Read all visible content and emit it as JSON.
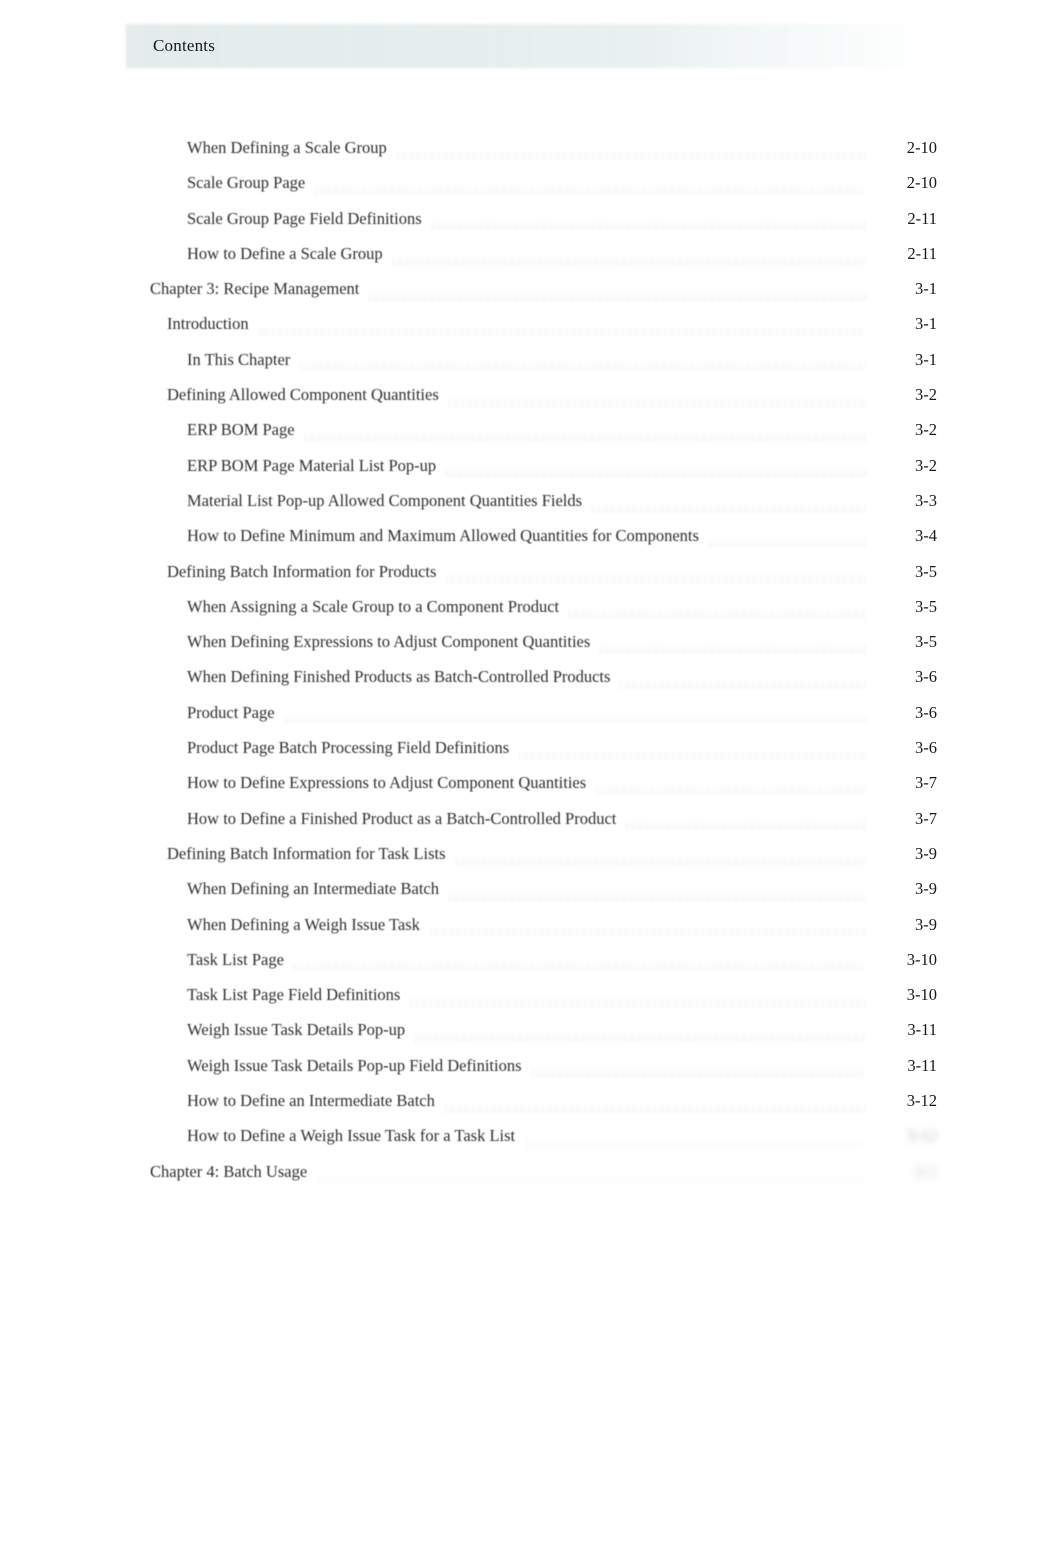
{
  "header": {
    "running_title": "Contents"
  },
  "toc": {
    "entries": [
      {
        "label": "When Defining a Scale Group",
        "page": "2-10",
        "level": 3,
        "state": "normal"
      },
      {
        "label": "Scale Group Page",
        "page": "2-10",
        "level": 3,
        "state": "normal"
      },
      {
        "label": "Scale Group Page Field Definitions",
        "page": "2-11",
        "level": 3,
        "state": "normal"
      },
      {
        "label": "How to Define a Scale Group",
        "page": "2-11",
        "level": 3,
        "state": "normal"
      },
      {
        "label": "Chapter 3: Recipe Management",
        "page": "3-1",
        "level": 1,
        "state": "normal"
      },
      {
        "label": "Introduction",
        "page": "3-1",
        "level": 2,
        "state": "normal"
      },
      {
        "label": "In This Chapter",
        "page": "3-1",
        "level": 3,
        "state": "normal"
      },
      {
        "label": "Defining Allowed Component Quantities",
        "page": "3-2",
        "level": 2,
        "state": "normal"
      },
      {
        "label": "ERP BOM Page",
        "page": "3-2",
        "level": 3,
        "state": "normal"
      },
      {
        "label": "ERP BOM Page Material List Pop-up",
        "page": "3-2",
        "level": 3,
        "state": "normal"
      },
      {
        "label": "Material List Pop-up Allowed Component Quantities Fields",
        "page": "3-3",
        "level": 3,
        "state": "normal"
      },
      {
        "label": "How to Define Minimum and Maximum Allowed Quantities for Components",
        "page": "3-4",
        "level": 3,
        "state": "normal"
      },
      {
        "label": "Defining Batch Information for Products",
        "page": "3-5",
        "level": 2,
        "state": "normal"
      },
      {
        "label": "When Assigning a Scale Group to a Component Product",
        "page": "3-5",
        "level": 3,
        "state": "normal"
      },
      {
        "label": "When Defining Expressions to Adjust Component Quantities",
        "page": "3-5",
        "level": 3,
        "state": "normal"
      },
      {
        "label": "When Defining Finished Products as Batch-Controlled Products",
        "page": "3-6",
        "level": 3,
        "state": "normal"
      },
      {
        "label": "Product Page",
        "page": "3-6",
        "level": 3,
        "state": "normal"
      },
      {
        "label": "Product Page Batch Processing Field Definitions",
        "page": "3-6",
        "level": 3,
        "state": "normal"
      },
      {
        "label": "How to Define Expressions to Adjust Component Quantities",
        "page": "3-7",
        "level": 3,
        "state": "normal"
      },
      {
        "label": "How to Define a Finished Product as a Batch-Controlled Product",
        "page": "3-7",
        "level": 3,
        "state": "normal"
      },
      {
        "label": "Defining Batch Information for Task Lists",
        "page": "3-9",
        "level": 2,
        "state": "normal"
      },
      {
        "label": "When Defining an Intermediate Batch",
        "page": "3-9",
        "level": 3,
        "state": "normal"
      },
      {
        "label": "When Defining a Weigh Issue Task",
        "page": "3-9",
        "level": 3,
        "state": "normal"
      },
      {
        "label": "Task List Page",
        "page": "3-10",
        "level": 3,
        "state": "normal"
      },
      {
        "label": "Task List Page Field Definitions",
        "page": "3-10",
        "level": 3,
        "state": "normal"
      },
      {
        "label": "Weigh Issue Task Details Pop-up",
        "page": "3-11",
        "level": 3,
        "state": "normal"
      },
      {
        "label": "Weigh Issue Task Details Pop-up Field Definitions",
        "page": "3-11",
        "level": 3,
        "state": "normal"
      },
      {
        "label": "How to Define an Intermediate Batch",
        "page": "3-12",
        "level": 3,
        "state": "normal"
      },
      {
        "label": "How to Define a Weigh Issue Task for a Task List",
        "page": "3-12",
        "level": 3,
        "state": "faded"
      },
      {
        "label": "Chapter 4: Batch Usage",
        "page": "4-1",
        "level": 1,
        "state": "faded-heavy"
      }
    ]
  }
}
